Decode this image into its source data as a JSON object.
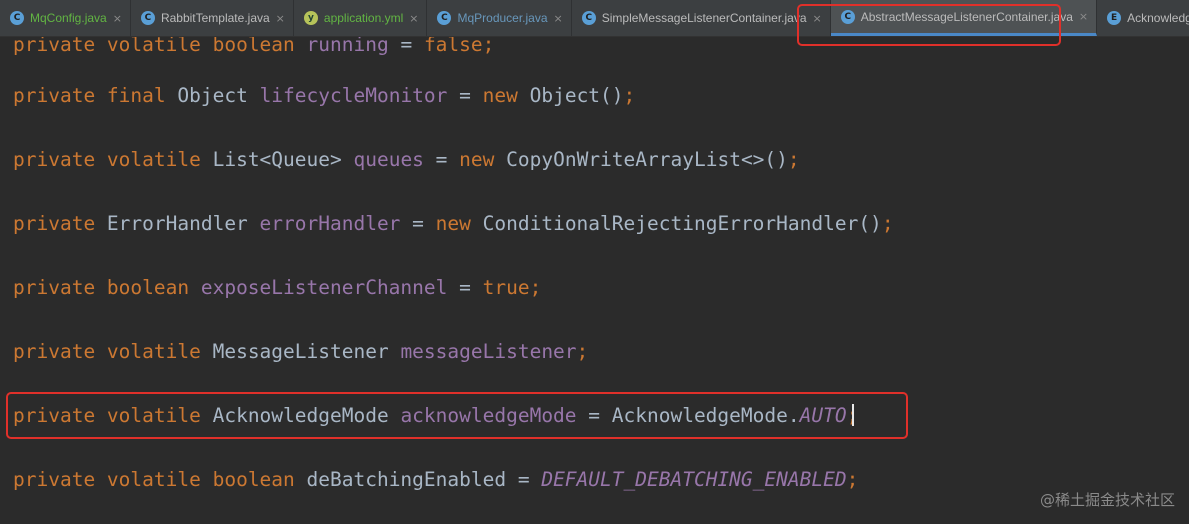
{
  "tabs": [
    {
      "label": "MqConfig.java",
      "badge": "C",
      "badge_type": "c",
      "color": "#62b543"
    },
    {
      "label": "RabbitTemplate.java",
      "badge": "C",
      "badge_type": "c",
      "color": "#bbbbbb"
    },
    {
      "label": "application.yml",
      "badge": "y",
      "badge_type": "y",
      "color": "#62b543"
    },
    {
      "label": "MqProducer.java",
      "badge": "C",
      "badge_type": "c",
      "color": "#6897bb"
    },
    {
      "label": "SimpleMessageListenerContainer.java",
      "badge": "C",
      "badge_type": "c",
      "color": "#bbbbbb"
    },
    {
      "label": "AbstractMessageListenerContainer.java",
      "badge": "C",
      "badge_type": "c",
      "color": "#bbbbbb",
      "active": true
    },
    {
      "label": "AcknowledgeMode.java",
      "badge": "E",
      "badge_type": "c",
      "color": "#bbbbbb"
    }
  ],
  "close_glyph": "×",
  "code_lines": [
    [
      [
        "kw",
        "private "
      ],
      [
        "kw",
        "volatile "
      ],
      [
        "kw",
        "boolean "
      ],
      [
        "fld",
        "running"
      ],
      [
        "p",
        " = "
      ],
      [
        "kw",
        "false;"
      ]
    ],
    [
      [
        "kw",
        "private "
      ],
      [
        "kw",
        "final "
      ],
      [
        "p",
        "Object "
      ],
      [
        "fld",
        "lifecycleMonitor"
      ],
      [
        "p",
        " = "
      ],
      [
        "kw",
        "new "
      ],
      [
        "p",
        "Object()"
      ],
      [
        "kw",
        ";"
      ]
    ],
    [
      [
        "kw",
        "private "
      ],
      [
        "kw",
        "volatile "
      ],
      [
        "p",
        "List<Queue> "
      ],
      [
        "fld",
        "queues"
      ],
      [
        "p",
        " = "
      ],
      [
        "kw",
        "new "
      ],
      [
        "p",
        "CopyOnWriteArrayList<>()"
      ],
      [
        "kw",
        ";"
      ]
    ],
    [
      [
        "kw",
        "private "
      ],
      [
        "p",
        "ErrorHandler "
      ],
      [
        "fld",
        "errorHandler"
      ],
      [
        "p",
        " = "
      ],
      [
        "kw",
        "new "
      ],
      [
        "p",
        "ConditionalRejectingErrorHandler()"
      ],
      [
        "kw",
        ";"
      ]
    ],
    [
      [
        "kw",
        "private "
      ],
      [
        "kw",
        "boolean "
      ],
      [
        "fld",
        "exposeListenerChannel"
      ],
      [
        "p",
        " = "
      ],
      [
        "kw",
        "true;"
      ]
    ],
    [
      [
        "kw",
        "private "
      ],
      [
        "kw",
        "volatile "
      ],
      [
        "p",
        "MessageListener "
      ],
      [
        "fld",
        "messageListener"
      ],
      [
        "kw",
        ";"
      ]
    ],
    [
      [
        "kw",
        "private "
      ],
      [
        "kw",
        "volatile "
      ],
      [
        "p",
        "AcknowledgeMode "
      ],
      [
        "fld",
        "acknowledgeMode"
      ],
      [
        "p",
        " = AcknowledgeMode."
      ],
      [
        "st",
        "AUTO"
      ],
      [
        "kw",
        ";"
      ]
    ],
    [
      [
        "kw",
        "private "
      ],
      [
        "kw",
        "volatile "
      ],
      [
        "kw",
        "boolean "
      ],
      [
        "p",
        "deBatchingEnabled = "
      ],
      [
        "st",
        "DEFAULT_DEBATCHING_ENABLED"
      ],
      [
        "kw",
        ";"
      ]
    ]
  ],
  "watermark": "@稀土掘金技术社区"
}
